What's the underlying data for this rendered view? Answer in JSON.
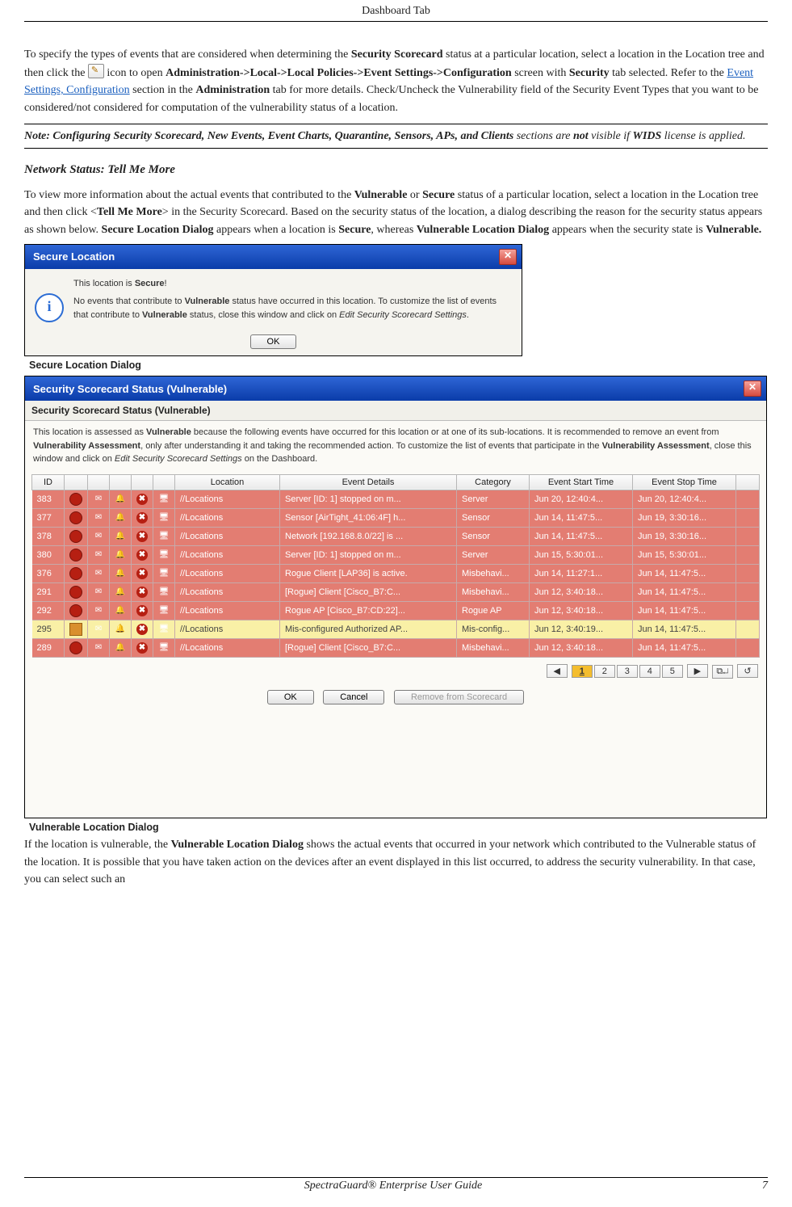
{
  "header": {
    "title": "Dashboard Tab"
  },
  "para1": {
    "t1": "To specify the types of events that are considered when determining the ",
    "b1": "Security Scorecard",
    "t2": " status at a particular location, select a location in the Location tree and then click the ",
    "icon_name": "edit-settings-icon",
    "t3": " icon to open ",
    "b2": "Administration->Local->Local Policies->Event Settings->Configuration",
    "t4": " screen with ",
    "b3": "Security",
    "t5": " tab selected. Refer to the ",
    "link": "Event Settings, Configuration",
    "t6": " section in the ",
    "b4": "Administration",
    "t7": " tab for more details. Check/Uncheck the Vulnerability field of the Security Event Types that you want to be considered/not considered for computation of the vulnerability status of a location."
  },
  "note": {
    "b1": "Note: Configuring Security Scorecard, New Events, Event Charts, Quarantine, Sensors, APs, and Clients",
    "t1": " sections are ",
    "b2": "not",
    "t2": " visible if ",
    "b3": "WIDS",
    "t3": " license is applied."
  },
  "heading2": "Network Status: Tell Me More",
  "para2": {
    "t1": "To view more information about the actual events that contributed to the ",
    "b1": "Vulnerable",
    "t2": " or ",
    "b2": "Secure",
    "t3": " status of a particular location, select a location in the Location tree and then click <",
    "b3": "Tell Me More",
    "t4": "> in the Security Scorecard. Based on the security status of the location, a dialog describing the reason for the security status appears as shown below. ",
    "b4": "Secure Location Dialog",
    "t5": " appears when a location is ",
    "b5": "Secure",
    "t6": ", whereas ",
    "b6": "Vulnerable Location Dialog",
    "t7": " appears when the security state is ",
    "b7": "Vulnerable."
  },
  "secure_dialog": {
    "title": "Secure Location",
    "line1a": "This location is ",
    "line1b": "Secure",
    "line1c": "!",
    "line2a": "No events that contribute to ",
    "line2b": "Vulnerable",
    "line2c": " status have occurred in this location. To customize the list of events that contribute to ",
    "line3b": "Vulnerable",
    "line3c": " status, close this window and click on ",
    "line3i": "Edit Security Scorecard Settings",
    "line3d": ".",
    "ok": "OK"
  },
  "caption1": "Secure Location Dialog",
  "vuln_dialog": {
    "title": "Security Scorecard Status (Vulnerable)",
    "sub_title": "Security Scorecard Status (Vulnerable)",
    "desc_t1": "This location is assessed as ",
    "desc_b1": "Vulnerable",
    "desc_t2": " because the following events have occurred for this location or at one of its sub-locations. It is recommended to remove an event from ",
    "desc_b2": "Vulnerability Assessment",
    "desc_t3": ", only after understanding it and taking the recommended action. To customize the list of events that participate in the ",
    "desc_b3": "Vulnerability Assessment",
    "desc_t4": ", close this window and click on ",
    "desc_i1": "Edit Security Scorecard Settings",
    "desc_t5": " on the Dashboard.",
    "columns": {
      "id": "ID",
      "location": "Location",
      "details": "Event Details",
      "category": "Category",
      "start": "Event Start Time",
      "stop": "Event Stop Time"
    },
    "rows": [
      {
        "id": "383",
        "sev": "red",
        "loc": "//Locations",
        "det": "Server [ID: 1] stopped on m...",
        "cat": "Server",
        "start": "Jun 20, 12:40:4...",
        "stop": "Jun 20, 12:40:4..."
      },
      {
        "id": "377",
        "sev": "red",
        "loc": "//Locations",
        "det": "Sensor [AirTight_41:06:4F] h...",
        "cat": "Sensor",
        "start": "Jun 14, 11:47:5...",
        "stop": "Jun 19, 3:30:16..."
      },
      {
        "id": "378",
        "sev": "red",
        "loc": "//Locations",
        "det": "Network [192.168.8.0/22] is ...",
        "cat": "Sensor",
        "start": "Jun 14, 11:47:5...",
        "stop": "Jun 19, 3:30:16..."
      },
      {
        "id": "380",
        "sev": "red",
        "loc": "//Locations",
        "det": "Server [ID: 1] stopped on m...",
        "cat": "Server",
        "start": "Jun 15, 5:30:01...",
        "stop": "Jun 15, 5:30:01..."
      },
      {
        "id": "376",
        "sev": "red",
        "loc": "//Locations",
        "det": "Rogue Client [LAP36] is active.",
        "cat": "Misbehavi...",
        "start": "Jun 14, 11:27:1...",
        "stop": "Jun 14, 11:47:5..."
      },
      {
        "id": "291",
        "sev": "red",
        "loc": "//Locations",
        "det": "[Rogue] Client [Cisco_B7:C...",
        "cat": "Misbehavi...",
        "start": "Jun 12, 3:40:18...",
        "stop": "Jun 14, 11:47:5..."
      },
      {
        "id": "292",
        "sev": "red",
        "loc": "//Locations",
        "det": "Rogue AP [Cisco_B7:CD:22]...",
        "cat": "Rogue AP",
        "start": "Jun 12, 3:40:18...",
        "stop": "Jun 14, 11:47:5..."
      },
      {
        "id": "295",
        "sev": "yellow",
        "loc": "//Locations",
        "det": "Mis-configured Authorized AP...",
        "cat": "Mis-config...",
        "start": "Jun 12, 3:40:19...",
        "stop": "Jun 14, 11:47:5..."
      },
      {
        "id": "289",
        "sev": "red",
        "loc": "//Locations",
        "det": "[Rogue] Client [Cisco_B7:C...",
        "cat": "Misbehavi...",
        "start": "Jun 12, 3:40:18...",
        "stop": "Jun 14, 11:47:5..."
      }
    ],
    "pager": {
      "prev": "◀",
      "pages": [
        "1",
        "2",
        "3",
        "4",
        "5"
      ],
      "next": "▶",
      "copy": "⧉↵",
      "refresh": "↺"
    },
    "ok": "OK",
    "cancel": "Cancel",
    "remove": "Remove from Scorecard"
  },
  "caption2": "Vulnerable Location Dialog",
  "para3": {
    "t1": "If the location is vulnerable, the ",
    "b1": "Vulnerable Location Dialog",
    "t2": " shows the actual events that occurred in your network which contributed to the Vulnerable status of the location. It is possible that you have taken action on the devices after an event displayed in this list occurred, to address the security vulnerability. In that case, you can select such an"
  },
  "footer": {
    "center": "SpectraGuard® Enterprise User Guide",
    "page": "7"
  }
}
